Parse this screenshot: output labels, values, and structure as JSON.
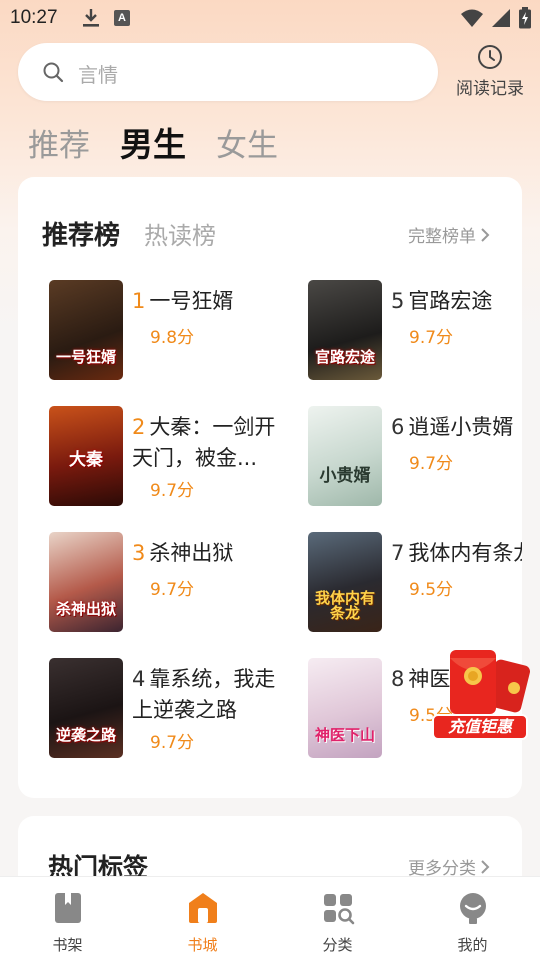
{
  "status_bar": {
    "time": "10:27",
    "a_icon": "A"
  },
  "search": {
    "placeholder": "言情"
  },
  "history": {
    "label": "阅读记录"
  },
  "top_tabs": [
    {
      "label": "推荐",
      "active": false
    },
    {
      "label": "男生",
      "active": true
    },
    {
      "label": "女生",
      "active": false
    }
  ],
  "rank": {
    "tabs": [
      {
        "label": "推荐榜",
        "active": true
      },
      {
        "label": "热读榜",
        "active": false
      }
    ],
    "full_list": "完整榜单",
    "books": [
      {
        "rank": "1",
        "title": "一号狂婿",
        "score": "9.8分",
        "cover_text": "一号狂婿"
      },
      {
        "rank": "2",
        "title": "大秦：一剑开天门，被金...",
        "score": "9.7分",
        "cover_text": "大秦"
      },
      {
        "rank": "3",
        "title": "杀神出狱",
        "score": "9.7分",
        "cover_text": "杀神出狱"
      },
      {
        "rank": "4",
        "title": "靠系统，我走上逆袭之路",
        "score": "9.7分",
        "cover_text": "逆袭之路"
      },
      {
        "rank": "5",
        "title": "官路宏途",
        "score": "9.7分",
        "cover_text": "官路宏途"
      },
      {
        "rank": "6",
        "title": "逍遥小贵婿",
        "score": "9.7分",
        "cover_text": "小贵婿"
      },
      {
        "rank": "7",
        "title": "我体内有条龙",
        "score": "9.5分",
        "cover_text": "我体内有条龙"
      },
      {
        "rank": "8",
        "title": "神医下山",
        "score": "9.5分",
        "cover_text": "神医下山"
      }
    ]
  },
  "promo": {
    "label": "充值钜惠"
  },
  "tags": {
    "title": "热门标签",
    "more": "更多分类"
  },
  "bottom_nav": [
    {
      "label": "书架",
      "icon": "bookshelf-icon",
      "active": false
    },
    {
      "label": "书城",
      "icon": "bookstore-icon",
      "active": true
    },
    {
      "label": "分类",
      "icon": "category-icon",
      "active": false
    },
    {
      "label": "我的",
      "icon": "profile-icon",
      "active": false
    }
  ],
  "colors": {
    "accent": "#f08a1a",
    "nav_active": "#f07f1b",
    "promo_red": "#e8261f"
  }
}
